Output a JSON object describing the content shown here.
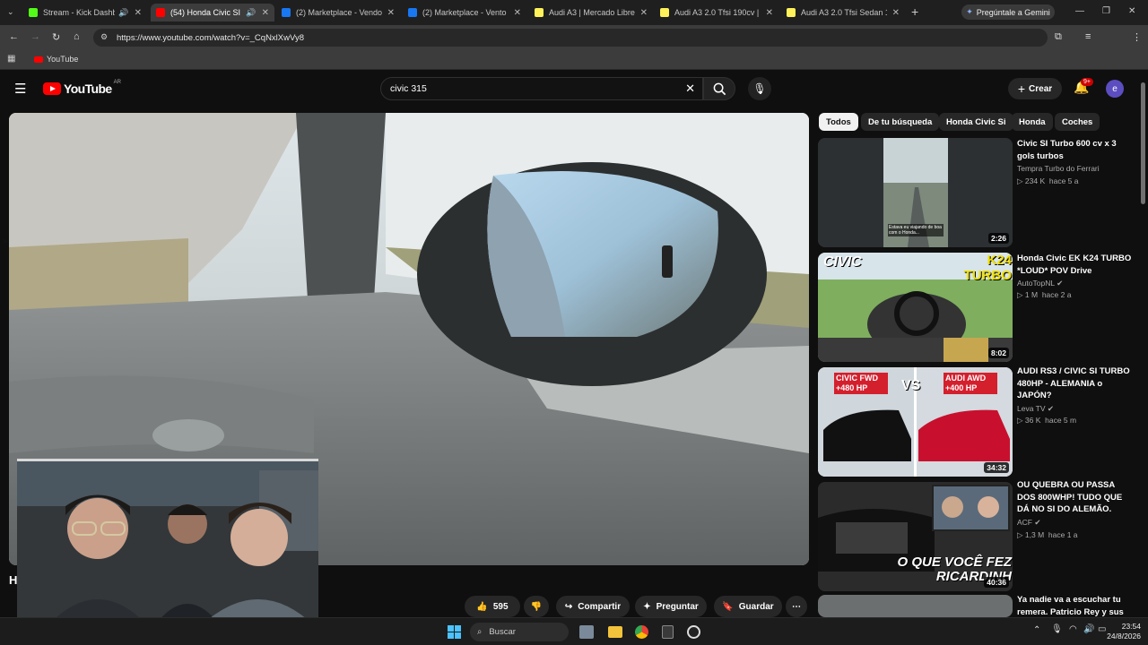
{
  "browser": {
    "tabs": [
      {
        "label": "Stream - Kick Dashbo...",
        "favicon_color": "#53fc18",
        "active": false,
        "audio": true
      },
      {
        "label": "(54) Honda Civic SI Tu...",
        "favicon_color": "#ff0000",
        "active": true,
        "audio": true
      },
      {
        "label": "(2) Marketplace - Vendo H...",
        "favicon_color": "#1877f2",
        "active": false,
        "audio": false
      },
      {
        "label": "(2) Marketplace - Vento 2...",
        "favicon_color": "#1877f2",
        "active": false,
        "audio": false
      },
      {
        "label": "Audi A3 | Mercado Libre",
        "favicon_color": "#fff159",
        "active": false,
        "audio": false
      },
      {
        "label": "Audi A3 2.0 Tfsi 190cv | M...",
        "favicon_color": "#fff159",
        "active": false,
        "audio": false
      },
      {
        "label": "Audi A3 2.0 Tfsi Sedan 19...",
        "favicon_color": "#fff159",
        "active": false,
        "audio": false
      }
    ],
    "gemini_label": "Pregúntale a Gemini",
    "url": "https://www.youtube.com/watch?v=_CqNxlXwVy8",
    "bookmark": "YouTube"
  },
  "youtube": {
    "logo": "YouTube",
    "country": "AR",
    "search_value": "civic 315",
    "create_label": "Crear",
    "notifications": "9+",
    "avatar_letter": "e",
    "accent": "#ff0000",
    "chips": [
      "Todos",
      "De tu búsqueda",
      "Honda Civic Si",
      "Honda",
      "Coches"
    ],
    "actions": {
      "likes": "595",
      "share": "Compartir",
      "ask": "Preguntar",
      "save": "Guardar"
    },
    "title_partial": "H",
    "recommendations": [
      {
        "title": "Civic SI Turbo  600 cv x 3 gols turbos",
        "channel": "Tempra Turbo do Ferrari",
        "views": "234 K",
        "age": "hace 5 a",
        "duration": "2:26",
        "verified": false,
        "thumb_caption": "Estava eu viajando de boa com o Honda..."
      },
      {
        "title": "Honda Civic EK K24 TURBO *LOUD* POV Drive",
        "channel": "AutoTopNL",
        "views": "1 M",
        "age": "hace 2 a",
        "duration": "8:02",
        "verified": true,
        "thumb_text_left": "CIVIC",
        "thumb_text_right": "K24 TURBO"
      },
      {
        "title": "AUDI RS3 / CIVIC SI TURBO 480HP - ALEMANIA o JAPÓN?",
        "channel": "Leva TV",
        "views": "36 K",
        "age": "hace 5 m",
        "duration": "34:32",
        "verified": true,
        "thumb_text_left": "CIVIC FWD +480 HP",
        "thumb_text_vs": "VS",
        "thumb_text_right": "AUDI AWD +400 HP"
      },
      {
        "title": "OU QUEBRA OU PASSA DOS 800WHP! TUDO QUE DÁ NO SI DO ALEMÃO.",
        "channel": "ACF",
        "views": "1,3 M",
        "age": "hace 1 a",
        "duration": "40:36",
        "verified": true,
        "thumb_text": "O QUE VOCÊ FEZ RICARDINH"
      },
      {
        "title": "Ya nadie va a escuchar tu remera. Patricio Rey y sus",
        "channel": "",
        "views": "",
        "age": "",
        "duration": "",
        "verified": false
      }
    ]
  },
  "taskbar": {
    "search_label": "Buscar",
    "time": "23:54",
    "date": "24/8/2026"
  }
}
